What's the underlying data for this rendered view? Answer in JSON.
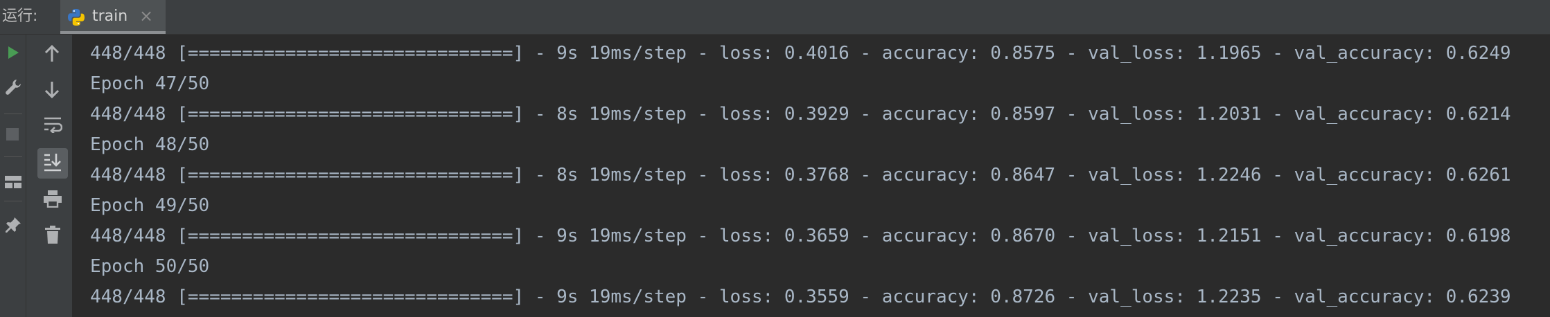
{
  "header": {
    "run_label": "运行:",
    "tab": {
      "label": "train",
      "icon": "python-icon",
      "close": "×"
    }
  },
  "toolbar_left": [
    "run-icon",
    "wrench-icon",
    "stop-icon",
    "layout-icon",
    "pin-icon"
  ],
  "toolbar_right": [
    "arrow-up-icon",
    "arrow-down-icon",
    "soft-wrap-icon",
    "scroll-to-end-icon",
    "print-icon",
    "trash-icon"
  ],
  "console": {
    "lines": [
      "448/448 [==============================] - 9s 19ms/step - loss: 0.4016 - accuracy: 0.8575 - val_loss: 1.1965 - val_accuracy: 0.6249",
      "Epoch 47/50",
      "448/448 [==============================] - 8s 19ms/step - loss: 0.3929 - accuracy: 0.8597 - val_loss: 1.2031 - val_accuracy: 0.6214",
      "Epoch 48/50",
      "448/448 [==============================] - 8s 19ms/step - loss: 0.3768 - accuracy: 0.8647 - val_loss: 1.2246 - val_accuracy: 0.6261",
      "Epoch 49/50",
      "448/448 [==============================] - 9s 19ms/step - loss: 0.3659 - accuracy: 0.8670 - val_loss: 1.2151 - val_accuracy: 0.6198",
      "Epoch 50/50",
      "448/448 [==============================] - 9s 19ms/step - loss: 0.3559 - accuracy: 0.8726 - val_loss: 1.2235 - val_accuracy: 0.6239"
    ]
  },
  "colors": {
    "background": "#2b2b2b",
    "toolbar": "#3c3f41",
    "text": "#a9b7c6",
    "run_green": "#499c54"
  }
}
